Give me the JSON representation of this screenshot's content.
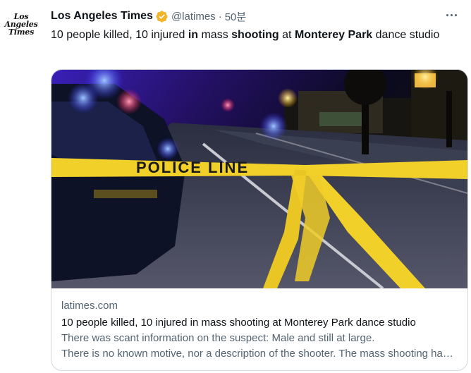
{
  "tweet": {
    "avatar": {
      "line1": "Los",
      "line2": "Angeles",
      "line3": "Times"
    },
    "author_name": "Los Angeles Times",
    "handle": "@latimes",
    "separator": "·",
    "time": "50분",
    "verified_icon": "verified-badge-icon",
    "more_icon": "more-options-icon",
    "text_parts": [
      {
        "text": "10 people killed, 10 injured ",
        "bold": false
      },
      {
        "text": "in",
        "bold": true
      },
      {
        "text": " mass ",
        "bold": false
      },
      {
        "text": "shooting",
        "bold": true
      },
      {
        "text": " at ",
        "bold": false
      },
      {
        "text": "Monterey Park",
        "bold": true
      },
      {
        "text": " dance studio",
        "bold": false
      }
    ]
  },
  "card": {
    "image_tape_text": "POLICE LINE",
    "domain": "latimes.com",
    "title": "10 people killed, 10 injured in mass shooting at Monterey Park dance studio",
    "description_line1": "There was scant information on the suspect: Male and still at large.",
    "description_line2": "There is no known motive, nor a description of the shooter. The mass shooting happened after the celebration."
  },
  "colors": {
    "verified": "#f4b52a",
    "tape": "#f2d02a",
    "secondary_text": "#536471",
    "border": "#cfd9de"
  }
}
